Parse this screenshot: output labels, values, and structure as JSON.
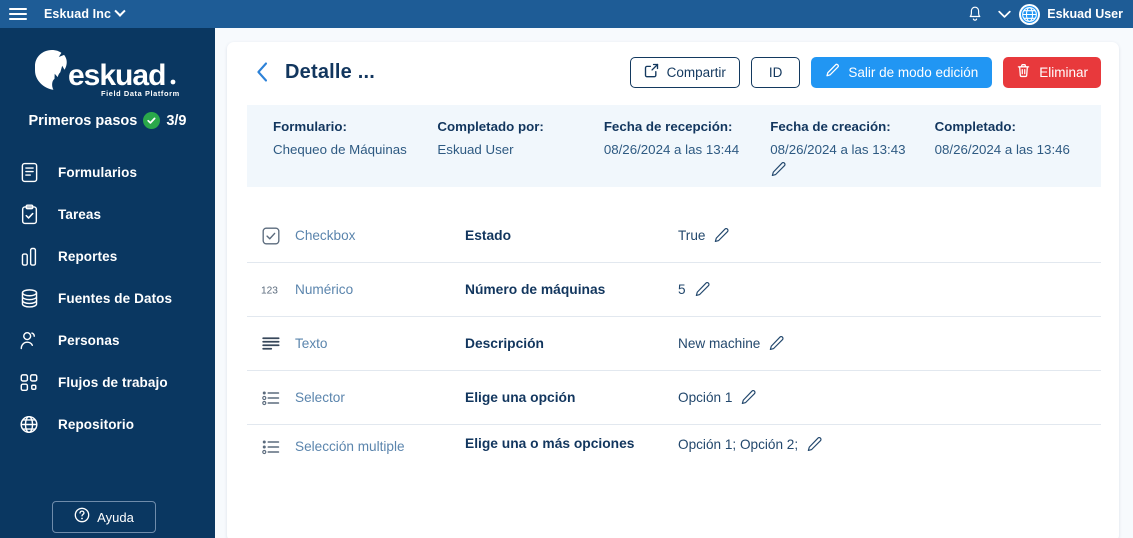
{
  "topbar": {
    "menu_icon": "hamburger-icon",
    "org_name": "Eskuad Inc",
    "bell_icon": "notification-bell-icon",
    "user_chevron_icon": "chevron-down-icon",
    "avatar_icon": "globe-avatar-icon",
    "user_name": "Eskuad User",
    "bg_color": "#1e5c96"
  },
  "sidebar": {
    "bg_color": "#0a3761",
    "logo": {
      "wordmark": "eskuad",
      "tagline": "Field Data Platform"
    },
    "onboarding": {
      "label": "Primeros pasos",
      "progress": "3/9",
      "badge_color": "#2aa84a"
    },
    "items": [
      {
        "label": "Formularios",
        "icon": "document-icon"
      },
      {
        "label": "Tareas",
        "icon": "clipboard-check-icon"
      },
      {
        "label": "Reportes",
        "icon": "bar-chart-icon"
      },
      {
        "label": "Fuentes de Datos",
        "icon": "database-icon"
      },
      {
        "label": "Personas",
        "icon": "person-icon"
      },
      {
        "label": "Flujos de trabajo",
        "icon": "workflow-icon"
      },
      {
        "label": "Repositorio",
        "icon": "globe-icon"
      }
    ],
    "help": {
      "label": "Ayuda",
      "icon": "question-circle-icon"
    }
  },
  "detail": {
    "back_icon": "chevron-left-icon",
    "title": "Detalle ...",
    "actions": {
      "share": {
        "label": "Compartir",
        "icon": "share-icon"
      },
      "id": {
        "label": "ID"
      },
      "exit_edit": {
        "label": "Salir de modo edición",
        "icon": "pencil-icon",
        "color": "#2196f3"
      },
      "delete": {
        "label": "Eliminar",
        "icon": "trash-icon",
        "color": "#e8393c"
      }
    },
    "meta": [
      {
        "label": "Formulario:",
        "value": "Chequeo de Máquinas",
        "editable": false
      },
      {
        "label": "Completado por:",
        "value": "Eskuad User",
        "editable": false
      },
      {
        "label": "Fecha de recepción:",
        "value": "08/26/2024 a las 13:44",
        "editable": false
      },
      {
        "label": "Fecha de creación:",
        "value": "08/26/2024 a las 13:43",
        "editable": true
      },
      {
        "label": "Completado:",
        "value": "08/26/2024 a las 13:46",
        "editable": false
      }
    ],
    "fields": [
      {
        "type": "Checkbox",
        "icon": "checkbox-icon",
        "name": "Estado",
        "value": "True"
      },
      {
        "type": "Numérico",
        "icon": "numeric-123-icon",
        "name": "Número de máquinas",
        "value": "5"
      },
      {
        "type": "Texto",
        "icon": "text-lines-icon",
        "name": "Descripción",
        "value": "New machine"
      },
      {
        "type": "Selector",
        "icon": "single-select-icon",
        "name": "Elige una opción",
        "value": "Opción 1"
      },
      {
        "type": "Selección multiple",
        "icon": "multi-select-icon",
        "name": "Elige una o más opciones",
        "value": "Opción 1; Opción 2;"
      }
    ]
  }
}
